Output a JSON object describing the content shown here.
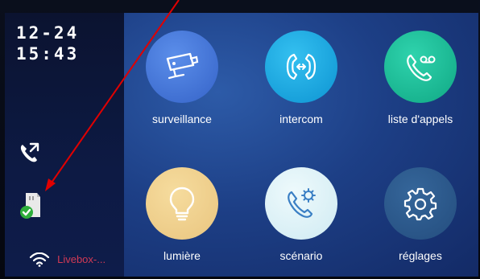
{
  "status": {
    "date": "12-24",
    "time": "15:43",
    "wifi_name": "Livebox-..."
  },
  "tiles": [
    {
      "label": "surveillance",
      "icon": "camera-icon",
      "color": "#3f74d6"
    },
    {
      "label": "intercom",
      "icon": "intercom-icon",
      "color": "#17a6e0"
    },
    {
      "label": "liste d'appels",
      "icon": "voicemail-icon",
      "color": "#18b995"
    },
    {
      "label": "lumière",
      "icon": "lightbulb-icon",
      "color": "#f0d08e"
    },
    {
      "label": "scénario",
      "icon": "phone-gear-icon",
      "color": "#d8f0f6"
    },
    {
      "label": "réglages",
      "icon": "gear-icon",
      "color": "#2a5686"
    }
  ],
  "colors": {
    "sidebar": "#0d1a44",
    "background": "#1d3f86",
    "arrow": "#e00000",
    "wifi_label": "#d23a55"
  }
}
